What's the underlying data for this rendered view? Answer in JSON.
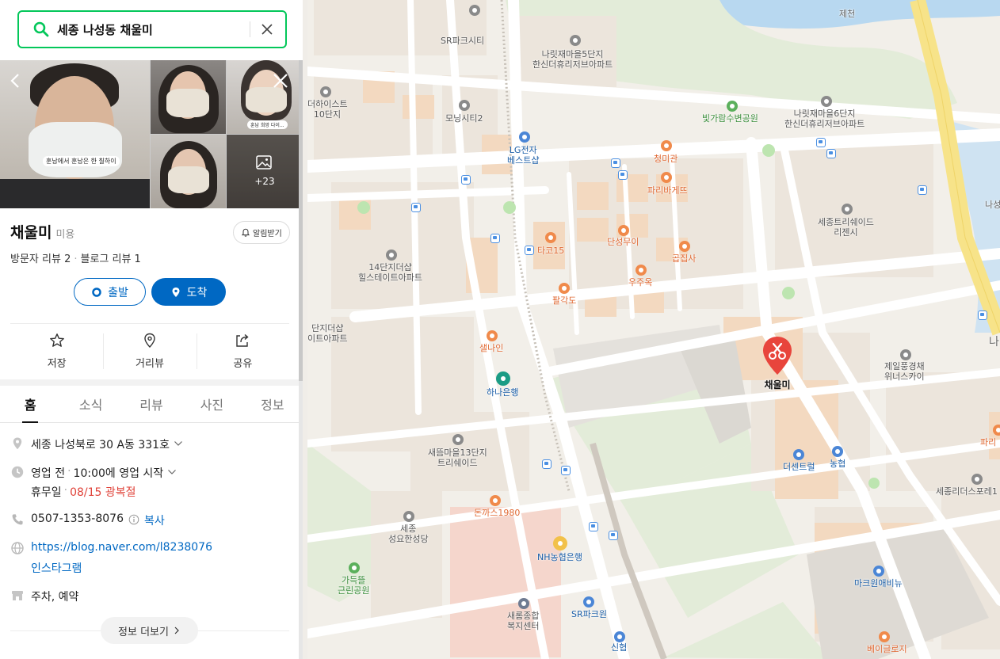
{
  "search": {
    "query": "세종 나성동 채울미"
  },
  "photos": {
    "more_count": "+23",
    "caption_main": "훈남에서 훈남은 한 칠하이",
    "caption_side": "훈남 희망 다이..."
  },
  "place": {
    "name": "채울미",
    "category": "미용",
    "alarm_label": "알림받기",
    "visitor_reviews": "방문자 리뷰 2",
    "blog_reviews": "블로그 리뷰 1"
  },
  "directions": {
    "start_label": "출발",
    "end_label": "도착"
  },
  "actions": {
    "save": "저장",
    "street_view": "거리뷰",
    "share": "공유"
  },
  "tabs": [
    "홈",
    "소식",
    "리뷰",
    "사진",
    "정보"
  ],
  "info": {
    "address": "세종 나성북로 30 A동 331호",
    "status": "영업 전",
    "hours": "10:00에 영업 시작",
    "holiday_label": "휴무일",
    "holiday_value": "08/15 광복절",
    "phone": "0507-1353-8076",
    "copy_label": "복사",
    "blog_url": "https://blog.naver.com/l8238076",
    "instagram": "인스타그램",
    "amenities": "주차, 예약",
    "more_label": "정보 더보기"
  },
  "map": {
    "selected_place": "채울미",
    "labels": [
      {
        "name": "SR파크시티",
        "type": "apt"
      },
      {
        "name": "나릿재마을5단지\n한신더휴리저브아파트",
        "type": "apt"
      },
      {
        "name": "제천",
        "type": "road"
      },
      {
        "name": "더하이스트\n10단지",
        "type": "apt"
      },
      {
        "name": "모닝시티2",
        "type": "apt"
      },
      {
        "name": "LG전자\n베스트샵",
        "type": "bank"
      },
      {
        "name": "빛가람수변공원",
        "type": "green"
      },
      {
        "name": "나릿재마을6단지\n한신더휴리저브아파트",
        "type": "apt"
      },
      {
        "name": "청미관",
        "type": "food"
      },
      {
        "name": "파리바게뜨",
        "type": "food"
      },
      {
        "name": "세종트리쉐이드\n리젠시",
        "type": "apt"
      },
      {
        "name": "나성",
        "type": "road"
      },
      {
        "name": "14단지더샵\n힐스테이트아파트",
        "type": "apt"
      },
      {
        "name": "타코15",
        "type": "food"
      },
      {
        "name": "단성무이",
        "type": "food"
      },
      {
        "name": "곱집사",
        "type": "food"
      },
      {
        "name": "우주옥",
        "type": "food"
      },
      {
        "name": "팔각도",
        "type": "food"
      },
      {
        "name": "단지더샵\n이트아파트",
        "type": "apt"
      },
      {
        "name": "샐나인",
        "type": "food"
      },
      {
        "name": "하나은행",
        "type": "bank"
      },
      {
        "name": "제일풍경채\n위너스카이",
        "type": "apt"
      },
      {
        "name": "나",
        "type": "road"
      },
      {
        "name": "새뜸마을13단지\n트리쉐이드",
        "type": "apt"
      },
      {
        "name": "더센트럴",
        "type": "bank"
      },
      {
        "name": "농협",
        "type": "bank"
      },
      {
        "name": "파리",
        "type": "food"
      },
      {
        "name": "세종리더스포레1",
        "type": "apt"
      },
      {
        "name": "돈까스1980",
        "type": "food"
      },
      {
        "name": "세종\n성요한성당",
        "type": "apt"
      },
      {
        "name": "NH농협은행",
        "type": "bank"
      },
      {
        "name": "가득뜰\n근린공원",
        "type": "green"
      },
      {
        "name": "마크원애비뉴",
        "type": "bank"
      },
      {
        "name": "새롬종합\n복지센터",
        "type": "apt"
      },
      {
        "name": "SR파크원",
        "type": "bank"
      },
      {
        "name": "신협",
        "type": "bank"
      },
      {
        "name": "베이글로지",
        "type": "food"
      }
    ]
  },
  "colors": {
    "brand_green": "#03c75a",
    "accent_blue": "#0068c3",
    "holiday_red": "#e0433a",
    "pin_red": "#e8453c",
    "highway_yellow": "#f7e389",
    "water": "#b8d8f0"
  }
}
